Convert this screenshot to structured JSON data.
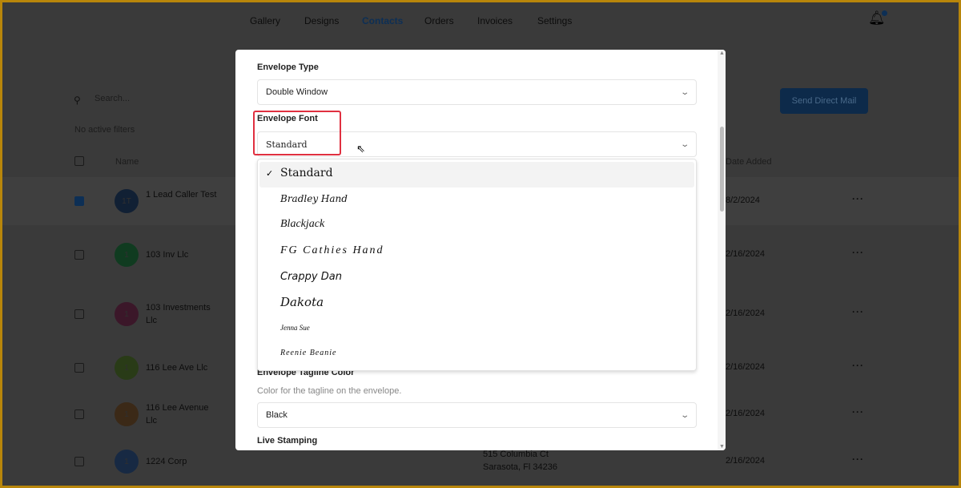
{
  "nav": {
    "items": [
      "Gallery",
      "Designs",
      "Contacts",
      "Orders",
      "Invoices",
      "Settings"
    ],
    "active": "Contacts"
  },
  "toolbar": {
    "search_placeholder": "Search...",
    "filters": "No active filters",
    "send_button": "Send Direct Mail"
  },
  "table": {
    "headers": {
      "name": "Name",
      "date": "Date Added"
    },
    "rows": [
      {
        "initials": "1T",
        "name": "1 Lead Caller Test",
        "date": "8/2/2024",
        "checked": true,
        "color": "#1f3a5f"
      },
      {
        "initials": "1",
        "name": "103 Inv Llc",
        "date": "2/16/2024",
        "checked": false,
        "color": "#1e6b3a"
      },
      {
        "initials": "1",
        "name": "103 Investments Llc",
        "date": "2/16/2024",
        "checked": false,
        "color": "#6b2a4a"
      },
      {
        "initials": "1",
        "name": "116 Lee Ave Llc",
        "date": "2/16/2024",
        "checked": false,
        "color": "#4a6b2a"
      },
      {
        "initials": "1",
        "name": "116 Lee Avenue Llc",
        "date": "2/16/2024",
        "checked": false,
        "color": "#6b4a2a"
      },
      {
        "initials": "1",
        "name": "1224 Corp",
        "date": "2/16/2024",
        "checked": false,
        "color": "#2a4a7a",
        "address": [
          "515 Columbia Ct",
          "Sarasota, Fl 34236"
        ]
      }
    ]
  },
  "modal": {
    "envelope_type": {
      "label": "Envelope Type",
      "value": "Double Window"
    },
    "envelope_font": {
      "label": "Envelope Font",
      "value": "Standard",
      "options": [
        "Standard",
        "Bradley Hand",
        "Blackjack",
        "FG Cathies Hand",
        "Crappy Dan",
        "Dakota",
        "Jenna Sue",
        "Reenie Beanie"
      ],
      "selected": "Standard"
    },
    "tagline_color": {
      "label": "Envelope Tagline Color",
      "description": "Color for the tagline on the envelope.",
      "value": "Black"
    },
    "live_stamping": {
      "label": "Live Stamping"
    }
  },
  "colors": {
    "highlight": "#e03040",
    "accent": "#1a4f8a"
  }
}
